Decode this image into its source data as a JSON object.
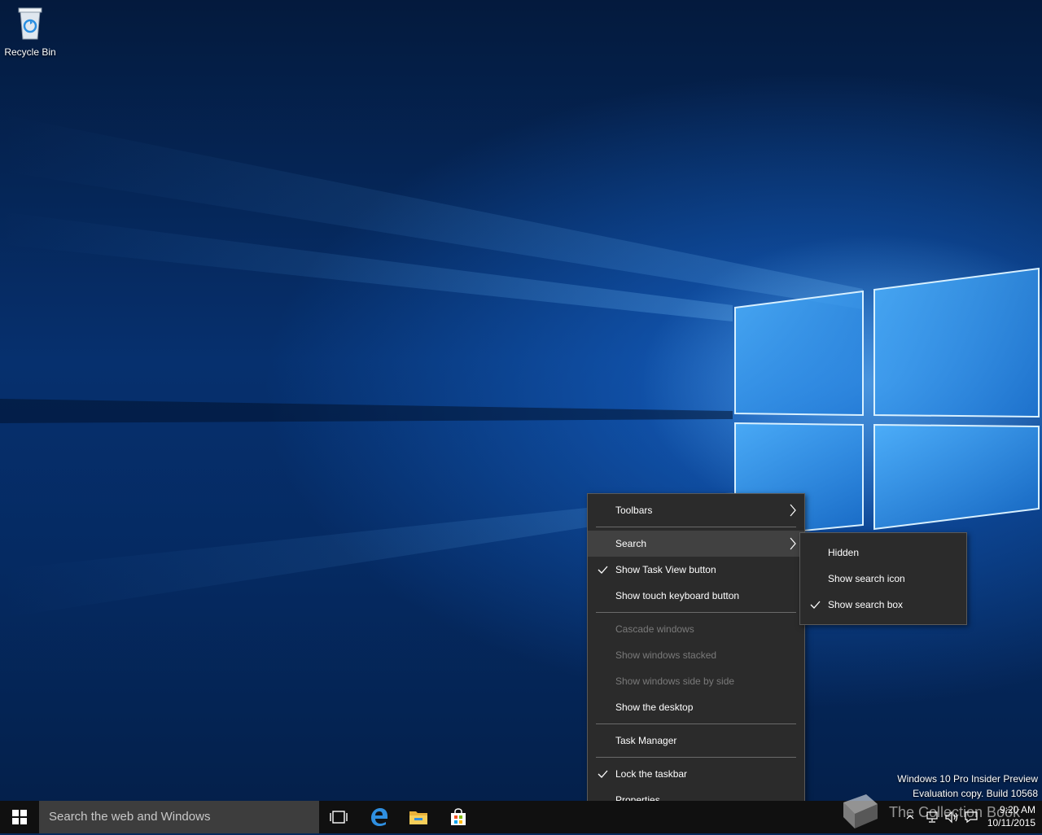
{
  "desktop": {
    "icons": [
      {
        "label": "Recycle Bin",
        "icon": "recycle-bin-icon"
      }
    ],
    "watermark": {
      "line1": "Windows 10 Pro Insider Preview",
      "line2": "Evaluation copy. Build 10568",
      "overlay_text": "The Collection Book"
    }
  },
  "taskbar": {
    "search_placeholder": "Search the web and Windows",
    "pinned": [
      {
        "name": "task-view-icon"
      },
      {
        "name": "edge-icon"
      },
      {
        "name": "file-explorer-icon"
      },
      {
        "name": "store-icon"
      }
    ],
    "clock": {
      "time": "9:20 AM",
      "date": "10/11/2015"
    }
  },
  "context_menu": {
    "items": [
      {
        "label": "Toolbars",
        "submenu": true
      },
      {
        "label": "Search",
        "submenu": true,
        "highlighted": true
      },
      {
        "label": "Show Task View button",
        "checked": true
      },
      {
        "label": "Show touch keyboard button"
      },
      {
        "label": "Cascade windows",
        "disabled": true
      },
      {
        "label": "Show windows stacked",
        "disabled": true
      },
      {
        "label": "Show windows side by side",
        "disabled": true
      },
      {
        "label": "Show the desktop"
      },
      {
        "label": "Task Manager"
      },
      {
        "label": "Lock the taskbar",
        "checked": true
      },
      {
        "label": "Properties"
      }
    ]
  },
  "search_submenu": {
    "items": [
      {
        "label": "Hidden"
      },
      {
        "label": "Show search icon"
      },
      {
        "label": "Show search box",
        "checked": true
      }
    ]
  },
  "colors": {
    "menu_bg": "#2b2b2b",
    "taskbar_bg": "#101010",
    "accent": "#1e90ff"
  }
}
